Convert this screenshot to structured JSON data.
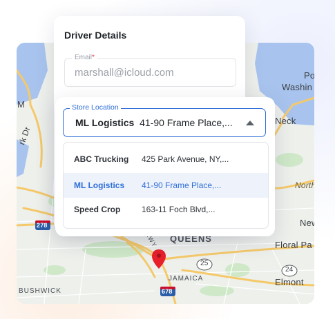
{
  "map": {
    "labels": {
      "port_washington_1": "Por",
      "port_washington_2": "Washin",
      "neck": "Neck",
      "north": "North",
      "new": "New",
      "floral_park": "Floral Pa",
      "elmont": "Elmont",
      "queens": "QUEENS",
      "jamaica": "JAMAICA",
      "bushwick": "BUSHWICK",
      "pkwy": "PKWY",
      "m": "M",
      "rk_dr": "rk Dr",
      "route_278": "278",
      "route_25": "25",
      "route_24": "24",
      "route_678": "678"
    }
  },
  "form": {
    "title": "Driver Details",
    "email": {
      "label": "Email",
      "required_mark": "*",
      "value": "marshall@icloud.com"
    },
    "store": {
      "label": "Store Location",
      "selected_name": "ML Logistics",
      "selected_address": "41-90 Frame Place,..."
    },
    "options": [
      {
        "name": "ABC Trucking",
        "address": "425 Park Avenue, NY,..."
      },
      {
        "name": "ML Logistics",
        "address": "41-90 Frame Place,..."
      },
      {
        "name": "Speed Crop",
        "address": "163-11 Foch Blvd,..."
      }
    ],
    "selected_index": 1
  },
  "colors": {
    "accent": "#2f6fd8",
    "pin": "#e8202c",
    "road": "#f5c96a",
    "park": "#cfe8c8",
    "water": "#a8c4ee"
  }
}
